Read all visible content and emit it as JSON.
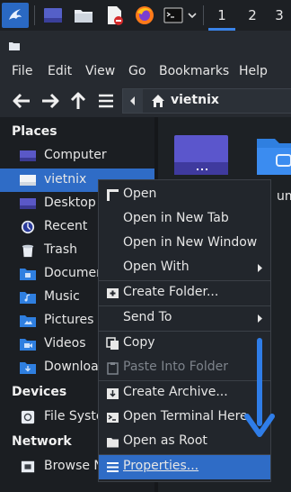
{
  "panel": {
    "workspaces": [
      "1",
      "2",
      "3"
    ]
  },
  "menubar": {
    "items": [
      "File",
      "Edit",
      "View",
      "Go",
      "Bookmarks",
      "Help"
    ]
  },
  "path": {
    "current": "vietnix"
  },
  "sidebar": {
    "places_header": "Places",
    "places": [
      {
        "label": "Computer",
        "icon": "computer-icon"
      },
      {
        "label": "vietnix",
        "icon": "home-folder-icon"
      },
      {
        "label": "Desktop",
        "icon": "desktop-icon"
      },
      {
        "label": "Recent",
        "icon": "recent-icon"
      },
      {
        "label": "Trash",
        "icon": "trash-icon"
      },
      {
        "label": "Documen",
        "icon": "documents-folder-icon"
      },
      {
        "label": "Music",
        "icon": "music-folder-icon"
      },
      {
        "label": "Pictures",
        "icon": "pictures-folder-icon"
      },
      {
        "label": "Videos",
        "icon": "videos-folder-icon"
      },
      {
        "label": "Downloac",
        "icon": "downloads-folder-icon"
      }
    ],
    "devices_header": "Devices",
    "devices": [
      {
        "label": "File Syste",
        "icon": "drive-icon"
      }
    ],
    "network_header": "Network",
    "network": [
      {
        "label": "Browse N",
        "icon": "network-icon"
      }
    ]
  },
  "main": {
    "partial_label": "ume"
  },
  "context_menu": {
    "items": [
      {
        "label": "Open",
        "icon": "open-icon"
      },
      {
        "label": "Open in New Tab"
      },
      {
        "label": "Open in New Window"
      },
      {
        "label": "Open With",
        "submenu": true
      },
      {
        "label": "Create Folder...",
        "icon": "add-folder-icon"
      },
      {
        "label": "Send To",
        "submenu": true
      },
      {
        "label": "Copy",
        "icon": "copy-icon"
      },
      {
        "label": "Paste Into Folder",
        "icon": "paste-icon",
        "disabled": true
      },
      {
        "label": "Create Archive...",
        "icon": "archive-icon"
      },
      {
        "label": "Open Terminal Here",
        "icon": "terminal-icon"
      },
      {
        "label": "Open as Root",
        "icon": "folder-icon"
      },
      {
        "label": "Properties...",
        "icon": "properties-icon",
        "selected": true
      }
    ]
  },
  "colors": {
    "accent": "#2f6cc6",
    "annotation_arrow": "#2f7de8"
  }
}
